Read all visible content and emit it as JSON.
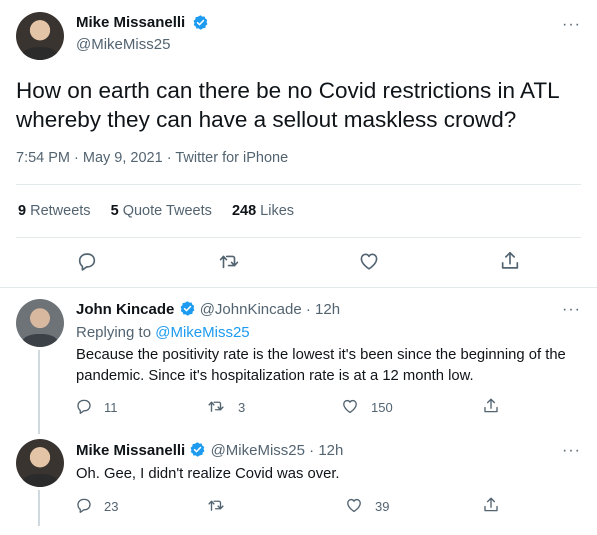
{
  "tweet": {
    "author_name": "Mike Missanelli",
    "author_handle": "@MikeMiss25",
    "text": "How on earth can there be no Covid restrictions in ATL whereby they can have a sellout maskless crowd?",
    "time": "7:54 PM",
    "date": "May 9, 2021",
    "source": "Twitter for iPhone",
    "retweets_count": "9",
    "retweets_label": "Retweets",
    "quote_count": "5",
    "quote_label": "Quote Tweets",
    "likes_count": "248",
    "likes_label": "Likes",
    "more_label": "···"
  },
  "replies": [
    {
      "author_name": "John Kincade",
      "author_handle": "@JohnKincade",
      "age": "12h",
      "replying_prefix": "Replying to",
      "replying_to": "@MikeMiss25",
      "text": "Because the positivity rate is the lowest it's been since the beginning of the pandemic. Since it's hospitalization rate is at a 12 month low.",
      "reply_count": "11",
      "retweet_count": "3",
      "like_count": "150",
      "more_label": "···"
    },
    {
      "author_name": "Mike Missanelli",
      "author_handle": "@MikeMiss25",
      "age": "12h",
      "text": "Oh. Gee, I didn't realize Covid was over.",
      "reply_count": "23",
      "retweet_count": "",
      "like_count": "39",
      "more_label": "···"
    }
  ],
  "icons": {
    "verified": "verified-badge-icon",
    "reply": "reply-icon",
    "retweet": "retweet-icon",
    "like": "like-icon",
    "share": "share-icon"
  },
  "colors": {
    "accent": "#1d9bf0",
    "text": "#0f1419",
    "muted": "#536471",
    "divider": "#e3e8eb"
  }
}
